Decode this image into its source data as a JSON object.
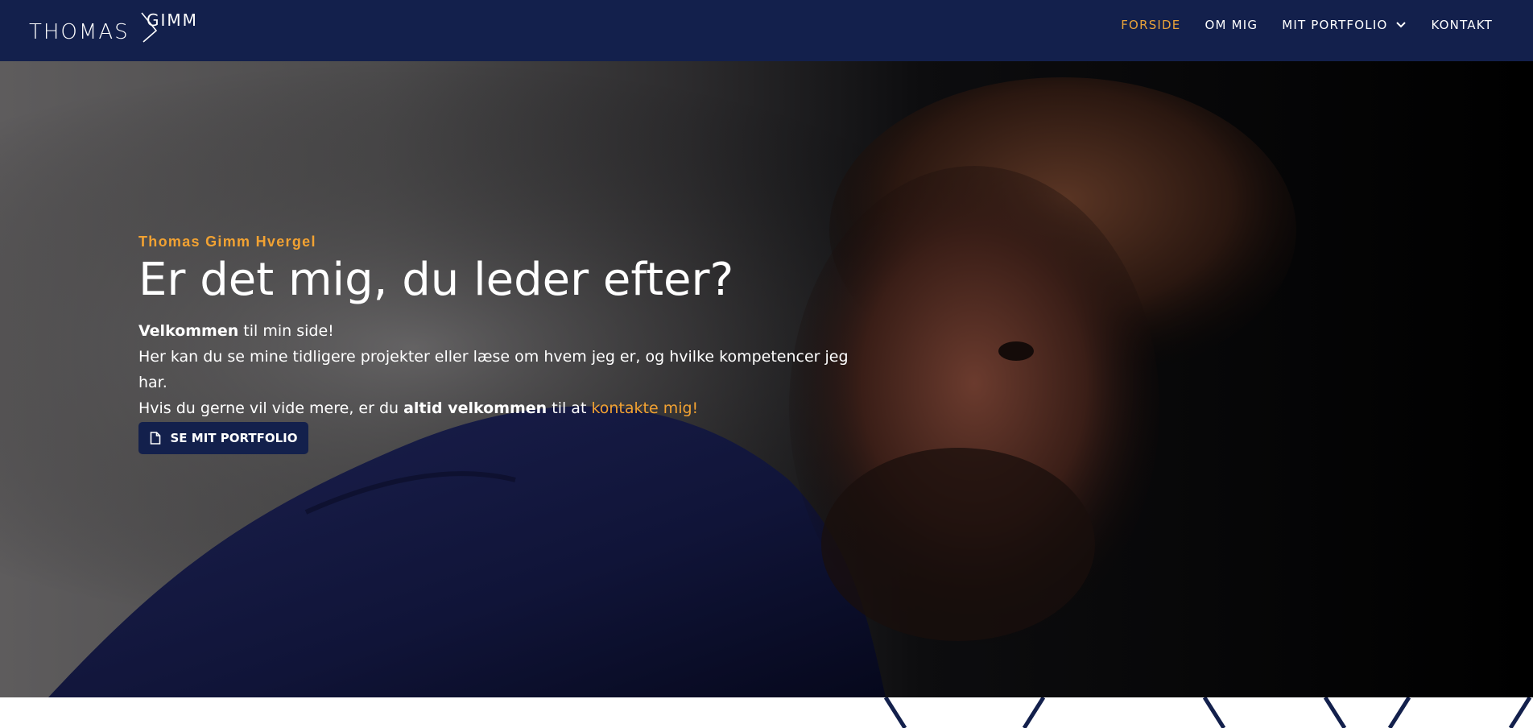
{
  "brand": {
    "logo_text_left": "THOMAS",
    "logo_text_right": "GIMM"
  },
  "nav": {
    "items": [
      {
        "label": "FORSIDE",
        "active": true
      },
      {
        "label": "OM MIG"
      },
      {
        "label": "MIT PORTFOLIO",
        "has_dropdown": true
      },
      {
        "label": "KONTAKT"
      }
    ]
  },
  "hero": {
    "eyebrow": "Thomas Gimm Hvergel",
    "title": "Er det mig, du leder efter?",
    "line1_bold": "Velkommen",
    "line1_rest": " til min side!",
    "line2": "Her kan du se mine tidligere projekter eller læse om hvem jeg er, og hvilke kompetencer jeg har.",
    "line3_a": "Hvis du gerne vil vide mere, er du ",
    "line3_bold": "altid velkommen",
    "line3_b": " til at ",
    "line3_link": "kontakte mig!",
    "cta_label": "SE MIT PORTFOLIO",
    "cta_icon": "file-icon"
  },
  "colors": {
    "navy": "#13204c",
    "accent": "#f2a232",
    "white": "#ffffff"
  }
}
